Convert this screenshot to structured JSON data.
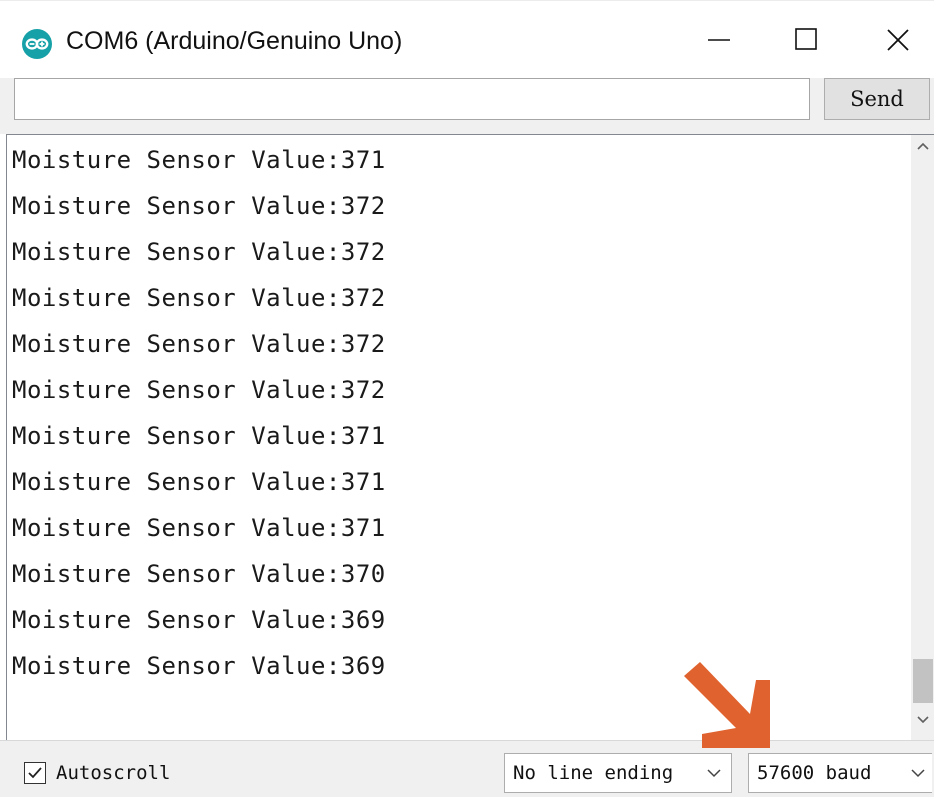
{
  "window": {
    "title": "COM6 (Arduino/Genuino Uno)",
    "icon": "arduino-logo-icon",
    "controls": [
      "minimize-icon",
      "maximize-icon",
      "close-icon"
    ]
  },
  "send_bar": {
    "input_value": "",
    "button_label": "Send"
  },
  "output": {
    "lines": [
      "Moisture Sensor Value:371",
      "Moisture Sensor Value:372",
      "Moisture Sensor Value:372",
      "Moisture Sensor Value:372",
      "Moisture Sensor Value:372",
      "Moisture Sensor Value:372",
      "Moisture Sensor Value:371",
      "Moisture Sensor Value:371",
      "Moisture Sensor Value:371",
      "Moisture Sensor Value:370",
      "Moisture Sensor Value:369",
      "Moisture Sensor Value:369"
    ],
    "scroll_position": "bottom"
  },
  "bottom_bar": {
    "autoscroll_label": "Autoscroll",
    "autoscroll_checked": true,
    "line_ending": "No line ending",
    "baud_rate": "57600 baud"
  },
  "annotation": {
    "type": "arrow",
    "color": "#e0622e",
    "points_to": "baud_rate"
  },
  "colors": {
    "arduino_teal": "#16a1a8",
    "annotation_orange": "#e0622e"
  }
}
